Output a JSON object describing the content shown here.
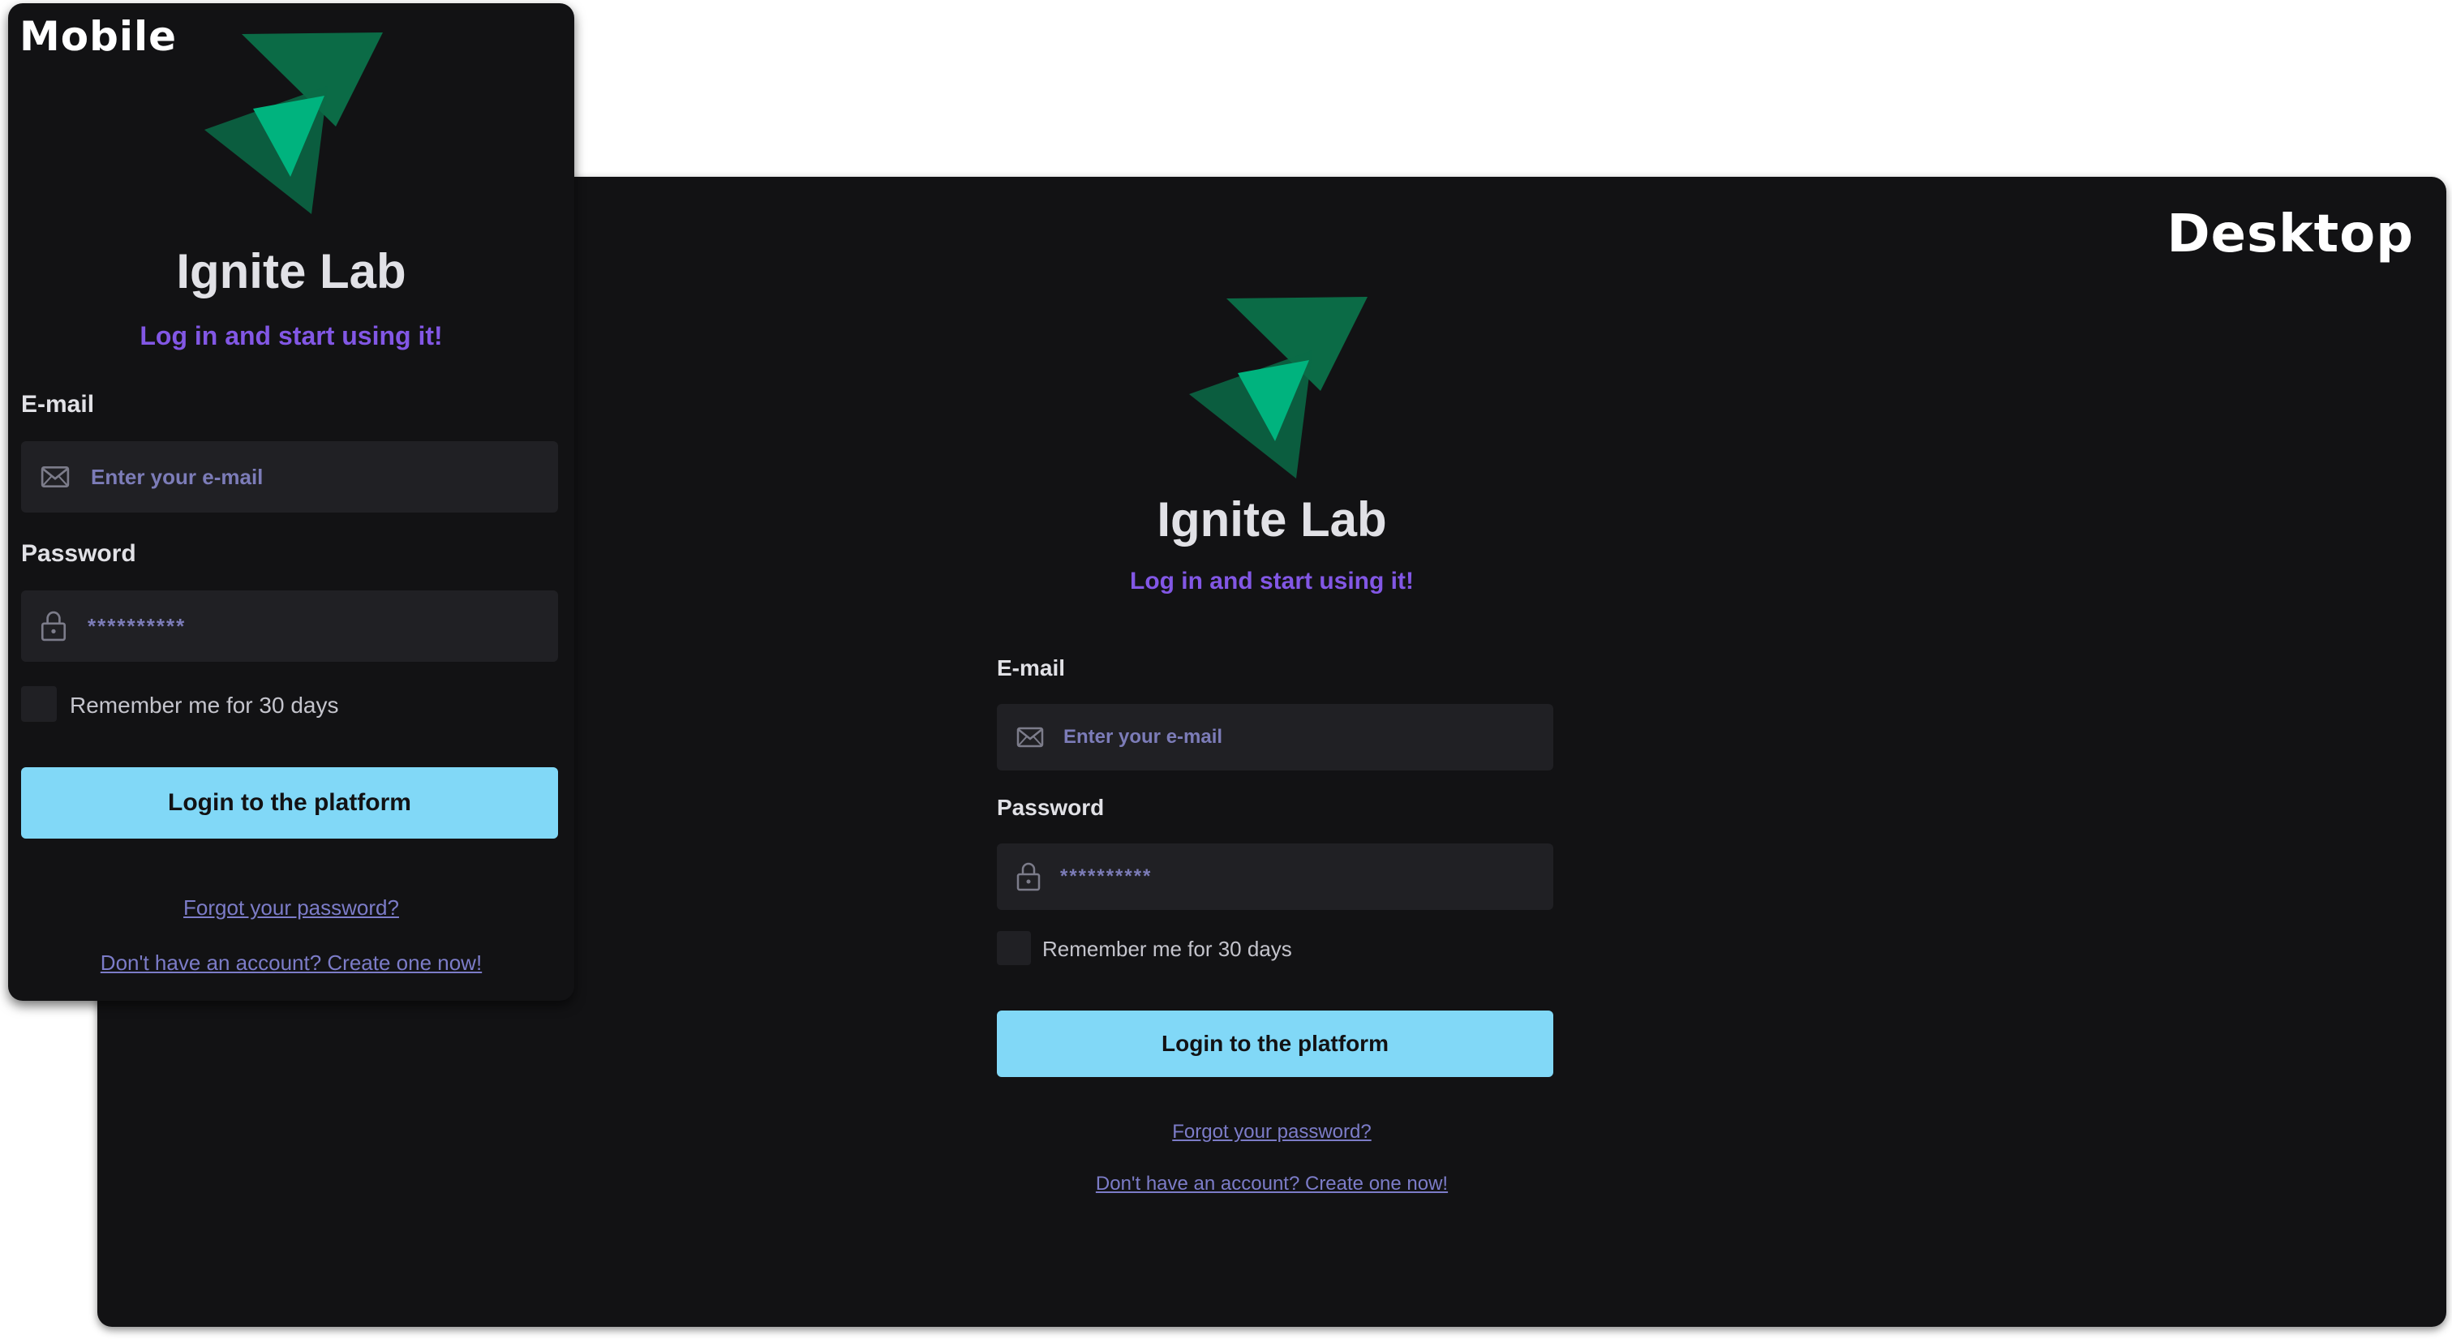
{
  "mobile": {
    "frame_label": "Mobile",
    "title": "Ignite Lab",
    "subtitle": "Log in and start using it!",
    "email_label": "E-mail",
    "email_placeholder": "Enter your e-mail",
    "password_label": "Password",
    "password_value": "**********",
    "remember_label": "Remember me for 30 days",
    "remember_checked": false,
    "login_button": "Login to the platform",
    "forgot_link": "Forgot your password?",
    "create_link": "Don't have an account? Create one now!"
  },
  "desktop": {
    "frame_label": "Desktop",
    "title": "Ignite Lab",
    "subtitle": "Log in and start using it!",
    "email_label": "E-mail",
    "email_placeholder": "Enter your e-mail",
    "password_label": "Password",
    "password_value": "**********",
    "remember_label": "Remember me for 30 days",
    "remember_checked": false,
    "login_button": "Login to the platform",
    "forgot_link": "Forgot your password?",
    "create_link": "Don't have an account? Create one now!"
  },
  "icons": {
    "logo": "ignite-lab-logo-icon",
    "email": "envelope-icon",
    "password": "lock-icon"
  },
  "colors": {
    "background": "#121214",
    "input_background": "#202024",
    "accent_purple": "#8257e5",
    "button_cyan": "#81d8f7",
    "logo_green_dark": "#0b6b46",
    "logo_green_light": "#00b37e"
  }
}
